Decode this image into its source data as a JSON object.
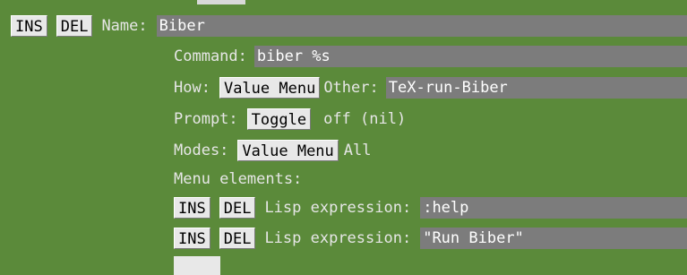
{
  "buttons": {
    "ins": "INS",
    "del": "DEL",
    "value_menu": "Value Menu",
    "toggle": "Toggle"
  },
  "name": {
    "label": "Name:",
    "value": "Biber"
  },
  "command": {
    "label": "Command:",
    "value": "biber %s"
  },
  "how": {
    "label": "How:",
    "button": "Value Menu",
    "other_label": "Other:",
    "other_value": "TeX-run-Biber"
  },
  "prompt": {
    "label": "Prompt:",
    "button": "Toggle",
    "value": "off (nil)"
  },
  "modes": {
    "label": "Modes:",
    "button": "Value Menu",
    "value": "All"
  },
  "menu_elements": {
    "label": "Menu elements:",
    "items": [
      {
        "label": "Lisp expression:",
        "value": ":help"
      },
      {
        "label": "Lisp expression:",
        "value": "\"Run Biber\""
      }
    ]
  },
  "colors": {
    "background": "#5b8a3a",
    "field": "#7c7c7c",
    "button": "#e8e8e8"
  }
}
